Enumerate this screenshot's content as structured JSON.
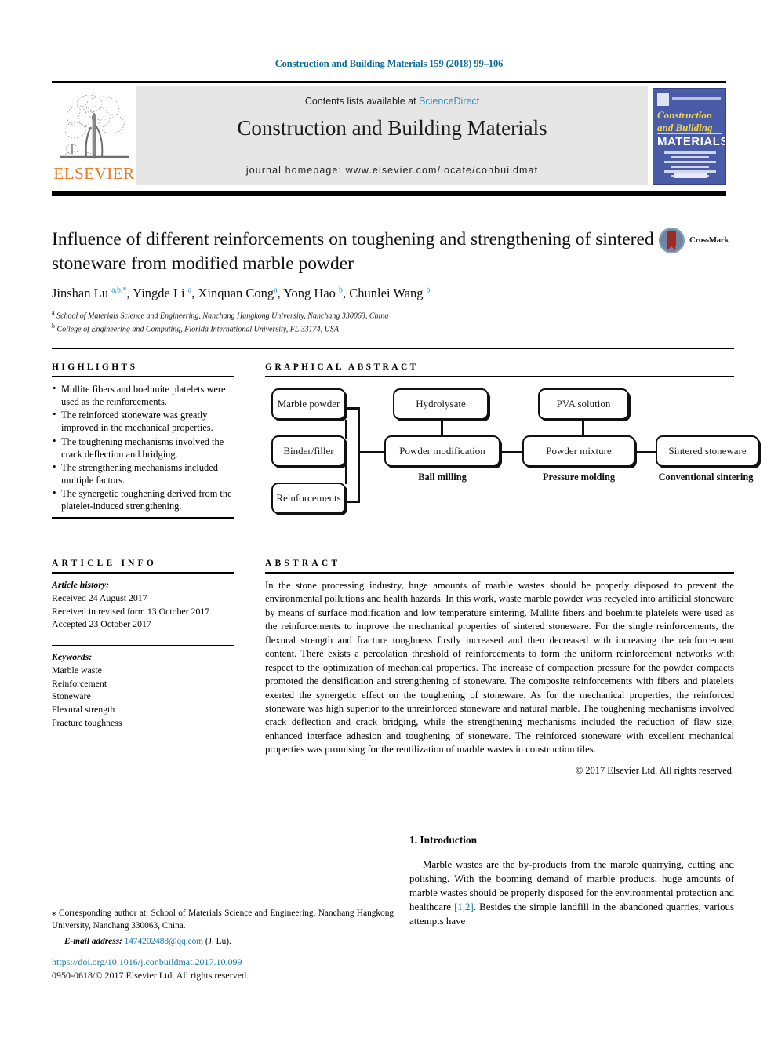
{
  "running_head": "Construction and Building Materials 159 (2018) 99–106",
  "masthead": {
    "publisher": "ELSEVIER",
    "contents_prefix": "Contents lists available at ",
    "contents_link": "ScienceDirect",
    "journal_title": "Construction and Building Materials",
    "homepage": "journal homepage: www.elsevier.com/locate/conbuildmat",
    "cover": {
      "line1": "Construction",
      "line2": "and Building",
      "line3": "MATERIALS"
    }
  },
  "article": {
    "title": "Influence of different reinforcements on toughening and strengthening of sintered stoneware from modified marble powder",
    "authors_html": "Jinshan Lu <sup>a,b,*</sup>, Yingde Li <sup>a</sup>, Xinquan Cong<sup>a</sup>, Yong Hao <sup>b</sup>, Chunlei Wang <sup>b</sup>",
    "affiliation_a": "School of Materials Science and Engineering, Nanchang Hangkong University, Nanchang 330063, China",
    "affiliation_b": "College of Engineering and Computing, Florida International University, FL 33174, USA",
    "crossmark_label": "CrossMark"
  },
  "highlights": {
    "heading": "HIGHLIGHTS",
    "items": [
      "Mullite fibers and boehmite platelets were used as the reinforcements.",
      "The reinforced stoneware was greatly improved in the mechanical properties.",
      "The toughening mechanisms involved the crack deflection and bridging.",
      "The strengthening mechanisms included multiple factors.",
      "The synergetic toughening derived from the platelet-induced strengthening."
    ]
  },
  "graphical_abstract": {
    "heading": "GRAPHICAL ABSTRACT",
    "boxes": [
      {
        "id": "marble-powder",
        "label": "Marble powder"
      },
      {
        "id": "binder-filler",
        "label": "Binder/filler"
      },
      {
        "id": "reinforcements",
        "label": "Reinforcements"
      },
      {
        "id": "hydrolysate",
        "label": "Hydrolysate"
      },
      {
        "id": "powder-modification",
        "label": "Powder modification"
      },
      {
        "id": "pva-solution",
        "label": "PVA solution"
      },
      {
        "id": "powder-mixture",
        "label": "Powder mixture"
      },
      {
        "id": "sintered-stoneware",
        "label": "Sintered stoneware"
      }
    ],
    "captions": [
      {
        "id": "ball-milling",
        "label": "Ball milling"
      },
      {
        "id": "pressure-molding",
        "label": "Pressure molding"
      },
      {
        "id": "conventional-sintering",
        "label": "Conventional sintering"
      }
    ]
  },
  "article_info": {
    "heading": "ARTICLE INFO",
    "history_label": "Article history:",
    "history": [
      "Received 24 August 2017",
      "Received in revised form 13 October 2017",
      "Accepted 23 October 2017"
    ],
    "keywords_label": "Keywords:",
    "keywords": [
      "Marble waste",
      "Reinforcement",
      "Stoneware",
      "Flexural strength",
      "Fracture toughness"
    ]
  },
  "abstract": {
    "heading": "ABSTRACT",
    "text": "In the stone processing industry, huge amounts of marble wastes should be properly disposed to prevent the environmental pollutions and health hazards. In this work, waste marble powder was recycled into artificial stoneware by means of surface modification and low temperature sintering. Mullite fibers and boehmite platelets were used as the reinforcements to improve the mechanical properties of sintered stoneware. For the single reinforcements, the flexural strength and fracture toughness firstly increased and then decreased with increasing the reinforcement content. There exists a percolation threshold of reinforcements to form the uniform reinforcement networks with respect to the optimization of mechanical properties. The increase of compaction pressure for the powder compacts promoted the densification and strengthening of stoneware. The composite reinforcements with fibers and platelets exerted the synergetic effect on the toughening of stoneware. As for the mechanical properties, the reinforced stoneware was high superior to the unreinforced stoneware and natural marble. The toughening mechanisms involved crack deflection and crack bridging, while the strengthening mechanisms included the reduction of flaw size, enhanced interface adhesion and toughening of stoneware. The reinforced stoneware with excellent mechanical properties was promising for the reutilization of marble wastes in construction tiles.",
    "copyright": "© 2017 Elsevier Ltd. All rights reserved."
  },
  "introduction": {
    "heading": "1. Introduction",
    "paragraph_part1": "Marble wastes are the by-products from the marble quarrying, cutting and polishing. With the booming demand of marble products, huge amounts of marble wastes should be properly disposed for the environmental protection and healthcare ",
    "citation": "[1,2]",
    "paragraph_part2": ". Besides the simple landfill in the abandoned quarries, various attempts have"
  },
  "footnote": {
    "corresponding": "⁎ Corresponding author at: School of Materials Science and Engineering, Nanchang Hangkong University, Nanchang 330063, China.",
    "email_label": "E-mail address:",
    "email": "1474202488@qq.com",
    "email_suffix": " (J. Lu)."
  },
  "bottom": {
    "doi": "https://doi.org/10.1016/j.conbuildmat.2017.10.099",
    "issn": "0950-0618/© 2017 Elsevier Ltd. All rights reserved."
  },
  "colors": {
    "link": "#1878a8",
    "runhead": "#0a6b9a",
    "elsevier_orange": "#E87722",
    "sciencedirect": "#2b8fbd",
    "cover_blue": "#4a5ba8"
  }
}
